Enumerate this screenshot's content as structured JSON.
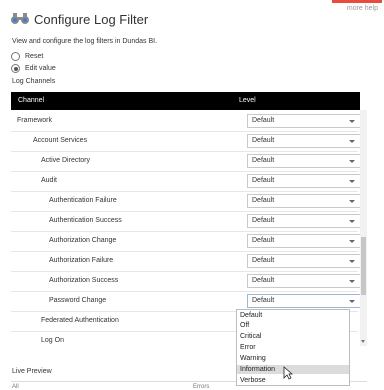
{
  "header": {
    "more_help": "more help",
    "title": "Configure Log Filter",
    "icon": "binoculars-icon"
  },
  "description": "View and configure the log filters in Dundas BI.",
  "mode": {
    "options": [
      {
        "label": "Reset",
        "selected": false
      },
      {
        "label": "Edit value",
        "selected": true
      }
    ]
  },
  "log_channels": {
    "section_label": "Log Channels",
    "columns": {
      "channel": "Channel",
      "level": "Level"
    },
    "rows": [
      {
        "name": "Framework",
        "level": "Default"
      },
      {
        "name": "Account Services",
        "level": "Default"
      },
      {
        "name": "Active Directory",
        "level": "Default"
      },
      {
        "name": "Audit",
        "level": "Default"
      },
      {
        "name": "Authentication Failure",
        "level": "Default"
      },
      {
        "name": "Authentication Success",
        "level": "Default"
      },
      {
        "name": "Authorization Change",
        "level": "Default"
      },
      {
        "name": "Authorization Failure",
        "level": "Default"
      },
      {
        "name": "Authorization Success",
        "level": "Default"
      },
      {
        "name": "Password Change",
        "level": "Default"
      },
      {
        "name": "Federated Authentication",
        "level": ""
      },
      {
        "name": "Log On",
        "level": ""
      }
    ]
  },
  "dropdown": {
    "options": [
      "Default",
      "Off",
      "Critical",
      "Error",
      "Warning",
      "Information",
      "Verbose"
    ],
    "hovered": "Information"
  },
  "preview": {
    "label": "Live Preview",
    "col_all": "All",
    "col_errors": "Errors"
  },
  "colors": {
    "accent": "#e74c3c",
    "icon_blue": "#3d7fd1",
    "header_bg": "#000000"
  }
}
